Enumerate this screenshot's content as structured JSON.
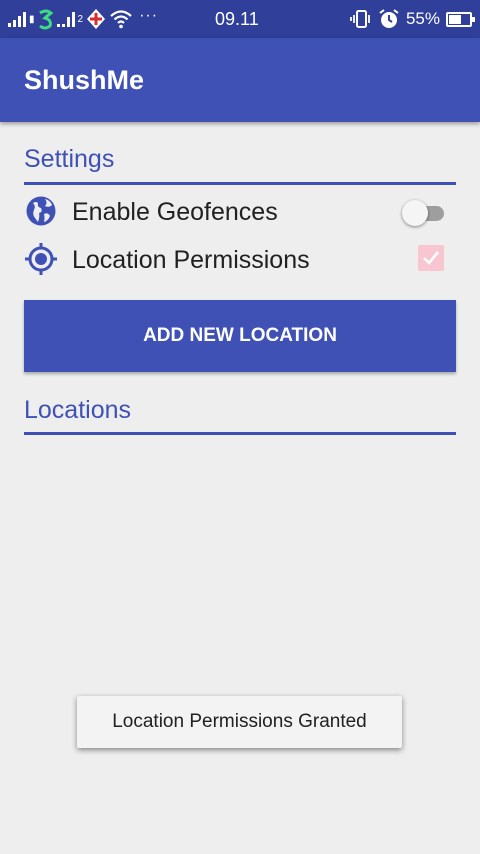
{
  "status_bar": {
    "sim2_label": "2",
    "time": "09.11",
    "battery_percent": "55%",
    "battery_level": 0.55
  },
  "app_bar": {
    "title": "ShushMe"
  },
  "settings": {
    "title": "Settings",
    "enable_geofences": {
      "label": "Enable Geofences",
      "enabled": false
    },
    "location_permissions": {
      "label": "Location Permissions",
      "checked": true
    }
  },
  "add_location_button": {
    "label": "ADD NEW LOCATION"
  },
  "locations": {
    "title": "Locations",
    "items": []
  },
  "toast": {
    "message": "Location Permissions Granted"
  },
  "colors": {
    "primary": "#3f51b5",
    "primary_dark": "#2f3f9a",
    "accent_checkbox": "#f7c6d1",
    "background": "#eeeeee"
  }
}
